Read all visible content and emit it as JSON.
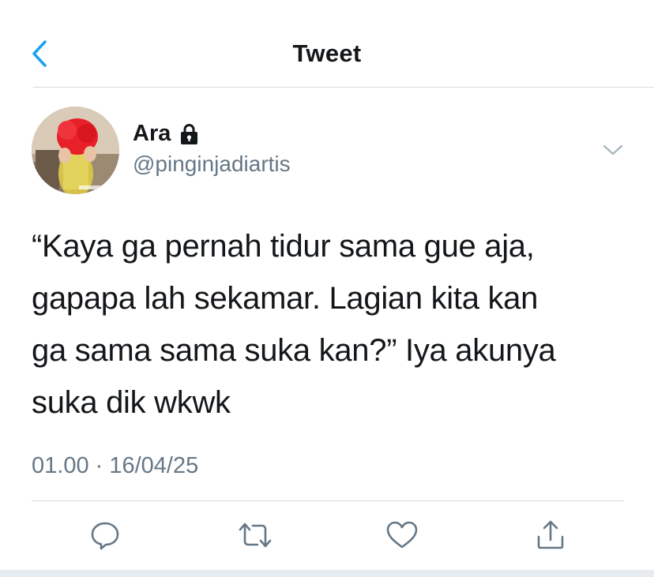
{
  "header": {
    "title": "Tweet",
    "back_icon": "chevron-left-icon"
  },
  "tweet": {
    "author": {
      "display_name": "Ara",
      "handle": "@pinginjadiartis",
      "protected_icon": "lock-icon"
    },
    "text": "“Kaya ga pernah tidur sama gue aja,\ngapapa lah sekamar. Lagian kita kan\nga sama sama suka kan?” Iya akunya\nsuka dik wkwk",
    "timestamp": "01.00 · 16/04/25"
  },
  "actions": [
    {
      "icon": "reply-icon"
    },
    {
      "icon": "retweet-icon"
    },
    {
      "icon": "like-icon"
    },
    {
      "icon": "share-icon"
    }
  ],
  "colors": {
    "accent": "#1da1f2",
    "text_primary": "#14171a",
    "text_secondary": "#657786",
    "icon": "#657786",
    "divider": "#d6dadf"
  }
}
